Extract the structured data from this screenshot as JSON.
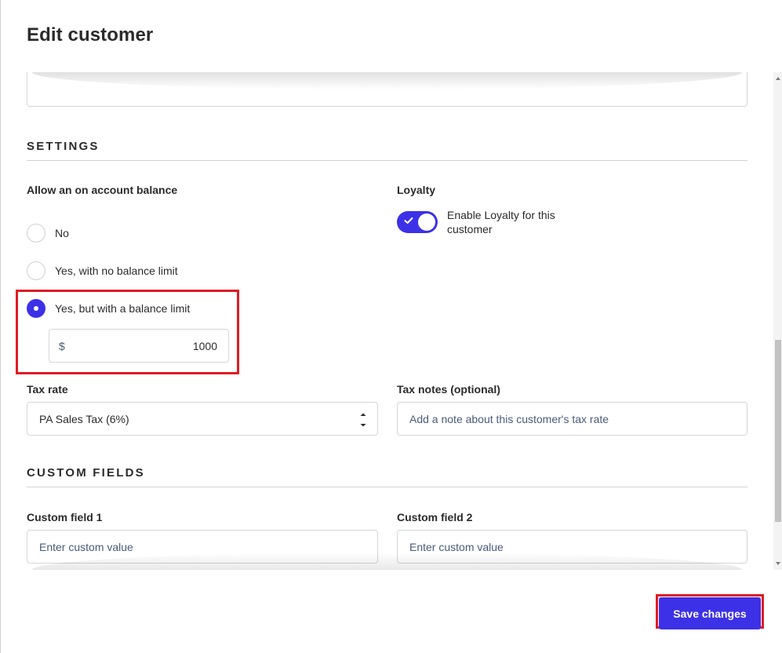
{
  "modal": {
    "title": "Edit customer"
  },
  "settings": {
    "header": "SETTINGS",
    "balance": {
      "label": "Allow an on account balance",
      "options": [
        {
          "label": "No",
          "checked": false
        },
        {
          "label": "Yes, with no balance limit",
          "checked": false
        },
        {
          "label": "Yes, but with a balance limit",
          "checked": true
        }
      ],
      "limit": {
        "prefix": "$",
        "value": "1000"
      }
    },
    "loyalty": {
      "label": "Loyalty",
      "toggle_label": "Enable Loyalty for this customer",
      "enabled": true
    },
    "tax_rate": {
      "label": "Tax rate",
      "value": "PA Sales Tax (6%)"
    },
    "tax_notes": {
      "label": "Tax notes (optional)",
      "placeholder": "Add a note about this customer's tax rate"
    }
  },
  "custom_fields": {
    "header": "CUSTOM FIELDS",
    "field1": {
      "label": "Custom field 1",
      "placeholder": "Enter custom value"
    },
    "field2": {
      "label": "Custom field 2",
      "placeholder": "Enter custom value"
    }
  },
  "footer": {
    "save_label": "Save changes"
  },
  "colors": {
    "accent": "#3d31e8",
    "highlight": "#e01b24"
  }
}
